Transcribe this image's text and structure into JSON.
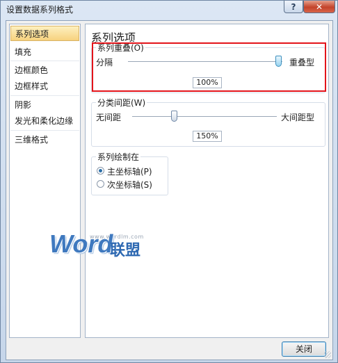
{
  "window": {
    "title": "设置数据系列格式",
    "help_icon": "?",
    "close_icon": "✕"
  },
  "sidebar": {
    "items": [
      {
        "label": "系列选项",
        "selected": true
      },
      {
        "label": "填充"
      },
      {
        "label": "边框颜色"
      },
      {
        "label": "边框样式"
      },
      {
        "label": "阴影"
      },
      {
        "label": "发光和柔化边缘"
      },
      {
        "label": "三维格式"
      }
    ]
  },
  "main": {
    "heading": "系列选项",
    "overlap": {
      "label": "系列重叠(O)",
      "left": "分隔",
      "right": "重叠型",
      "value": "100%",
      "slider_fraction": 1.0,
      "highlight_color": "#e3141a"
    },
    "gap": {
      "label": "分类间距(W)",
      "left": "无间距",
      "right": "大间距型",
      "value": "150%",
      "slider_fraction": 0.3
    },
    "plot_on": {
      "label": "系列绘制在",
      "options": [
        {
          "label": "主坐标轴(P)",
          "checked": true
        },
        {
          "label": "次坐标轴(S)",
          "checked": false
        }
      ]
    }
  },
  "watermark": {
    "url": "www.wordlm.com",
    "word": "Word",
    "cn": "联盟"
  },
  "footer": {
    "close_label": "关闭"
  }
}
